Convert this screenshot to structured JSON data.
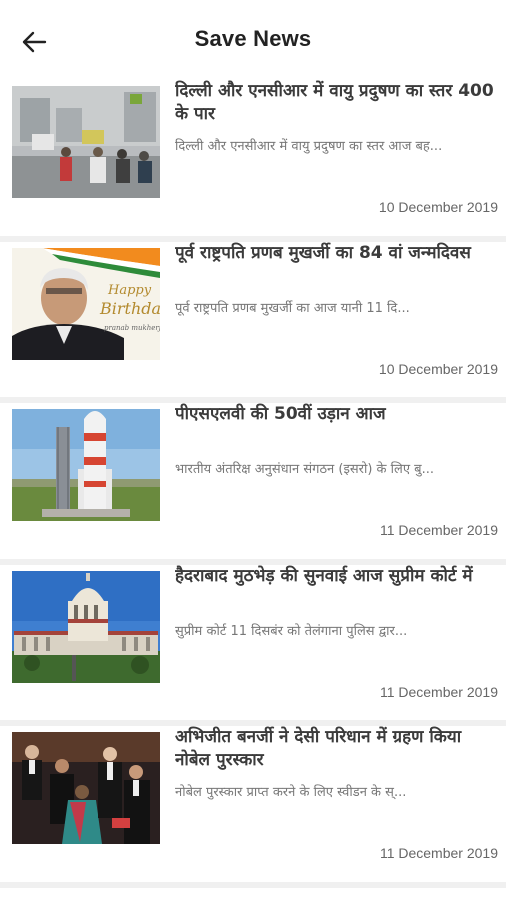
{
  "header": {
    "title": "Save News",
    "back_icon": "arrow-back-icon"
  },
  "news_items": [
    {
      "headline": "दिल्ली और एनसीआर में वायु प्रदुषण का स्तर 400 के पार",
      "excerpt": "दिल्ली और एनसीआर में वायु प्रदुषण का स्तर आज बह...",
      "date": "10 December 2019"
    },
    {
      "headline": "पूर्व राष्ट्रपति प्रणब मुखर्जी का 84 वां जन्मदिवस",
      "excerpt": "पूर्व राष्ट्रपति प्रणब मुखर्जी का आज यानी 11 दि...",
      "date": "10 December 2019",
      "image_text": {
        "greeting_1": "Happy",
        "greeting_2": "Birthday",
        "signature": "pranab mukherjee"
      }
    },
    {
      "headline": "पीएसएलवी की 50वीं उड़ान आज",
      "excerpt": "भारतीय अंतरिक्ष अनुसंधान संगठन (इसरो) के लिए बु...",
      "date": "11 December 2019"
    },
    {
      "headline": "हैदराबाद मुठभेड़ की सुनवाई आज सुप्रीम कोर्ट में",
      "excerpt": "सुप्रीम कोर्ट 11 दिसबंर को तेलंगाना पुलिस द्वार...",
      "date": "11 December 2019"
    },
    {
      "headline": "अभिजीत बनर्जी ने देसी परिधान में ग्रहण किया नोबेल पुरस्कार",
      "excerpt": "नोबेल पुरस्कार प्राप्त करने के लिए स्वीडन के स्...",
      "date": "11 December 2019"
    }
  ]
}
